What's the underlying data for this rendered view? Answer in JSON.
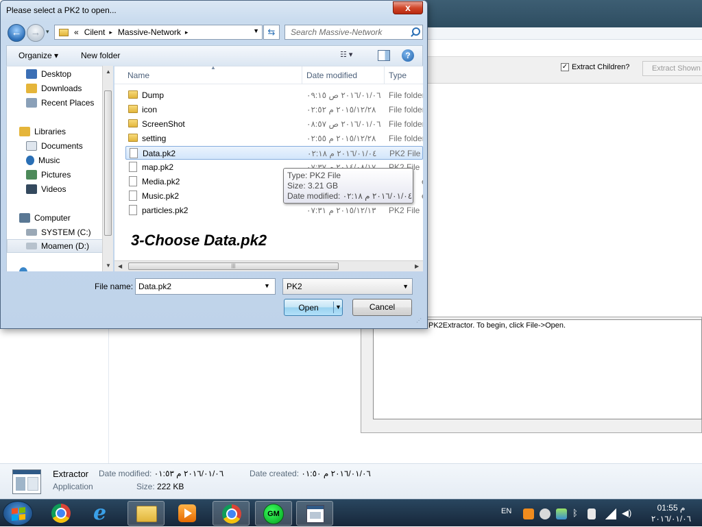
{
  "dialog": {
    "title": "Please select a PK2 to open...",
    "close_glyph": "x",
    "address": {
      "overflow": "«",
      "crumbs": [
        "Cilent",
        "Massive-Network"
      ],
      "sep": "▸"
    },
    "search_placeholder": "Search Massive-Network",
    "toolbar": {
      "organize": "Organize ▾",
      "new_folder": "New folder",
      "view": "☷ ▾",
      "help": "?"
    },
    "nav": {
      "items": [
        {
          "label": "Desktop",
          "color": "#3b6fb5"
        },
        {
          "label": "Downloads",
          "color": "#e5b53a"
        },
        {
          "label": "Recent Places",
          "color": "#8aa0b8"
        },
        {
          "label": "Libraries",
          "color": "#e5b53a"
        },
        {
          "label": "Documents",
          "color": "#dfe6ee"
        },
        {
          "label": "Music",
          "color": "#2a6fb5"
        },
        {
          "label": "Pictures",
          "color": "#4d8a5a"
        },
        {
          "label": "Videos",
          "color": "#34495e"
        },
        {
          "label": "Computer",
          "color": "#5a7894"
        },
        {
          "label": "SYSTEM (C:)",
          "color": "#9aa8b6"
        },
        {
          "label": "Moamen (D:)",
          "color": "#b7c2cd"
        }
      ]
    },
    "columns": {
      "name": "Name",
      "date": "Date modified",
      "type": "Type"
    },
    "files": [
      {
        "name": "Dump",
        "date": "٢٠١٦/٠١/٠٦ ص ٠٩:١٥",
        "type": "File folder",
        "kind": "folder"
      },
      {
        "name": "icon",
        "date": "٢٠١٥/١٢/٢٨ م ٠٢:٥٢",
        "type": "File folder",
        "kind": "folder"
      },
      {
        "name": "ScreenShot",
        "date": "٢٠١٦/٠١/٠٦ ص ٠٨:٥٧",
        "type": "File folder",
        "kind": "folder"
      },
      {
        "name": "setting",
        "date": "٢٠١٥/١٢/٢٨ م ٠٢:٥٥",
        "type": "File folder",
        "kind": "folder"
      },
      {
        "name": "Data.pk2",
        "date": "٢٠١٦/٠١/٠٤ م ٠٢:١٨",
        "type": "PK2 File",
        "kind": "file"
      },
      {
        "name": "map.pk2",
        "date": "٢٠١٤/٠٨/١٧ م ٠٧:٣٧",
        "type": "PK2 File",
        "kind": "file"
      },
      {
        "name": "Media.pk2",
        "date": "",
        "type": "e",
        "kind": "file"
      },
      {
        "name": "Music.pk2",
        "date": "",
        "type": "e",
        "kind": "file"
      },
      {
        "name": "particles.pk2",
        "date": "٢٠١٥/١٢/١٣ م ٠٧:٣١",
        "type": "PK2 File",
        "kind": "file"
      }
    ],
    "tooltip": {
      "type": "Type: PK2 File",
      "size": "Size: 3.21 GB",
      "date": "Date modified: ٢٠١٦/٠١/٠٤ م ٠٢:١٨"
    },
    "annotation": "3-Choose Data.pk2",
    "file_name_label": "File name:",
    "file_name_value": "Data.pk2",
    "file_type": "PK2",
    "open_label": "Open",
    "cancel_label": "Cancel"
  },
  "background_app": {
    "extract_children_label": "Extract Children?",
    "extract_children_checked": true,
    "extract_shown_label": "Extract Shown",
    "log_text": "PK2Extractor. To begin, click File->Open."
  },
  "details": {
    "name": "Extractor",
    "kind": "Application",
    "date_modified_label": "Date modified:",
    "date_modified": "٢٠١٦/٠١/٠٦ م ٠١:٥٣",
    "date_created_label": "Date created:",
    "date_created": "٢٠١٦/٠١/٠٦ م ٠١:٥٠",
    "size_label": "Size:",
    "size": "222 KB"
  },
  "taskbar": {
    "gm_label": "GM",
    "lang": "EN",
    "time": "م 01:55",
    "date": "٢٠١٦/٠١/٠٦"
  }
}
